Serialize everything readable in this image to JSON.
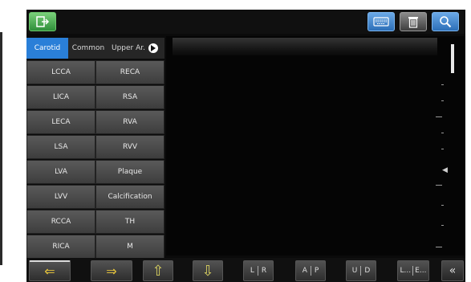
{
  "tabs": [
    {
      "label": "Carotid"
    },
    {
      "label": "Common"
    },
    {
      "label": "Upper Ar."
    }
  ],
  "grid": [
    [
      "LCCA",
      "RECA"
    ],
    [
      "LICA",
      "RSA"
    ],
    [
      "LECA",
      "RVA"
    ],
    [
      "LSA",
      "RVV"
    ],
    [
      "LVA",
      "Plaque"
    ],
    [
      "LVV",
      "Calcification"
    ],
    [
      "RCCA",
      "TH"
    ],
    [
      "RICA",
      "M"
    ]
  ],
  "bottom": {
    "lr_left": "L",
    "lr_right": "R",
    "ap_left": "A",
    "ap_right": "P",
    "ud_left": "U",
    "ud_right": "D",
    "le_left": "L...",
    "le_right": "E..."
  },
  "icons": {
    "exit": "exit-icon",
    "keyboard": "keyboard-icon",
    "trash": "trash-icon",
    "search": "search-icon",
    "collapse": "double-chevron-left-icon"
  },
  "colors": {
    "accent": "#2a7fd8",
    "arrow": "#e5c33b",
    "button": "#4a4a4a"
  }
}
